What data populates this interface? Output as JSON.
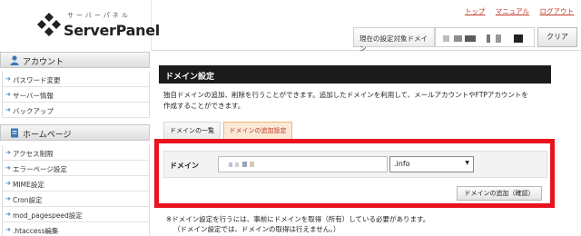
{
  "logo": {
    "kana": "サーバーパネル",
    "text": "ServerPanel"
  },
  "sidebar": {
    "account_head": "アカウント",
    "account_items": [
      "パスワード変更",
      "サーバー情報",
      "バックアップ"
    ],
    "homepage_head": "ホームページ",
    "homepage_items": [
      "アクセス制限",
      "エラーページ設定",
      "MIME設定",
      "Cron設定",
      "mod_pagespeed設定",
      ".htaccess編集"
    ]
  },
  "topbar": {
    "links": [
      "トップ",
      "マニュアル",
      "ログアウト"
    ],
    "target_label": "現在の設定対象ドメイン",
    "clear_label": "クリア"
  },
  "main": {
    "title": "ドメイン設定",
    "description_line1": "独自ドメインの追加、削除を行うことができます。追加したドメインを利用して、メールアカウントやFTPアカウントを",
    "description_line2": "作成することができます。",
    "tabs": [
      "ドメインの一覧",
      "ドメインの追加設定"
    ],
    "form": {
      "domain_label": "ドメイン",
      "domain_value": "",
      "tld_selected": ".info",
      "add_button": "ドメインの追加（確認）"
    },
    "note_line1": "※ドメイン設定を行うには、事前にドメインを取得（所有）している必要があります。",
    "note_line2": "（ドメイン設定では、ドメインの取得は行えません。）"
  },
  "colors": {
    "highlight": "#e8131e",
    "link": "#c0392b",
    "title_bar": "#1b1b1b",
    "active_tab": "#fbe9d5"
  },
  "icons": {
    "logo": "diamond-cluster-icon",
    "account": "person-icon",
    "homepage": "page-icon",
    "list_arrow": "arrow-icon",
    "select_caret": "caret-down-icon"
  }
}
